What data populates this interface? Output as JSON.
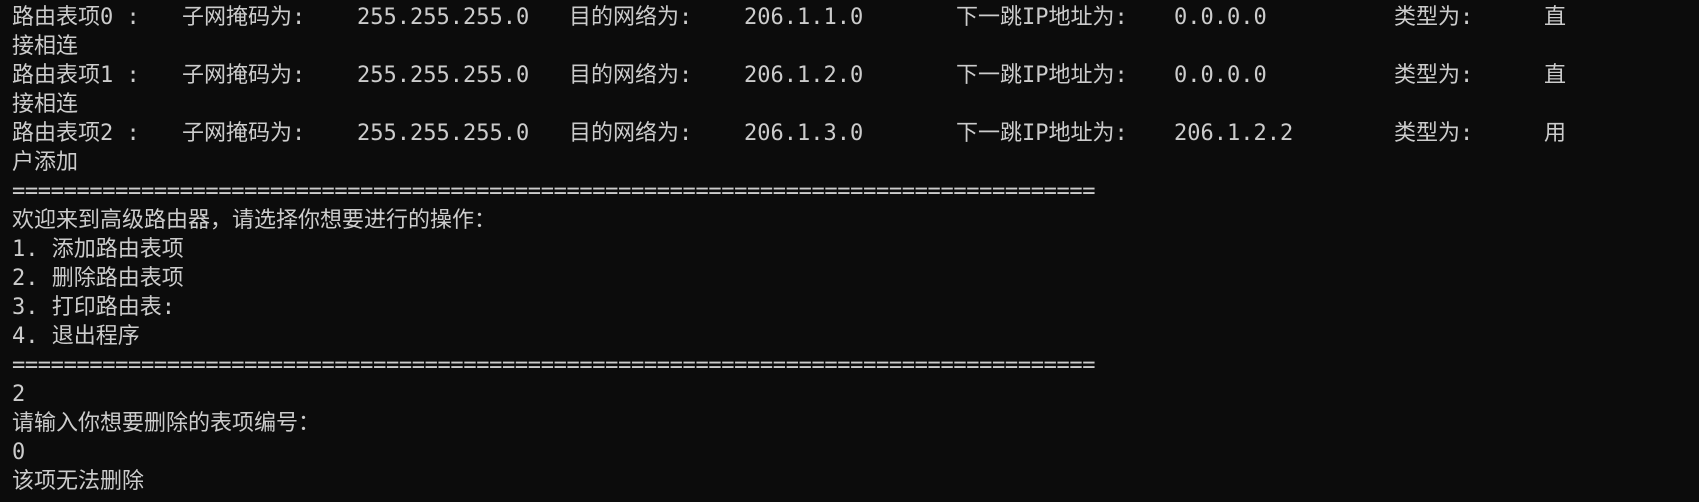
{
  "routes": [
    {
      "label": "路由表项0 :",
      "mask_label": "子网掩码为:",
      "mask": "255.255.255.0",
      "dest_label": "目的网络为:",
      "dest": "206.1.1.0",
      "next_label": "下一跳IP地址为:",
      "next": "0.0.0.0",
      "type_label": "类型为:",
      "type_head": "直",
      "type_tail": "接相连"
    },
    {
      "label": "路由表项1 :",
      "mask_label": "子网掩码为:",
      "mask": "255.255.255.0",
      "dest_label": "目的网络为:",
      "dest": "206.1.2.0",
      "next_label": "下一跳IP地址为:",
      "next": "0.0.0.0",
      "type_label": "类型为:",
      "type_head": "直",
      "type_tail": "接相连"
    },
    {
      "label": "路由表项2 :",
      "mask_label": "子网掩码为:",
      "mask": "255.255.255.0",
      "dest_label": "目的网络为:",
      "dest": "206.1.3.0",
      "next_label": "下一跳IP地址为:",
      "next": "206.1.2.2",
      "type_label": "类型为:",
      "type_head": "用",
      "type_tail": "户添加"
    }
  ],
  "separator": "==========================================================================================",
  "menu": {
    "welcome": "欢迎来到高级路由器，请选择你想要进行的操作：",
    "options": [
      "1. 添加路由表项",
      "2. 删除路由表项",
      "3. 打印路由表:",
      "4. 退出程序"
    ]
  },
  "session": {
    "choice": "2",
    "prompt": "请输入你想要删除的表项编号：",
    "entry": "0",
    "result": "该项无法删除"
  }
}
